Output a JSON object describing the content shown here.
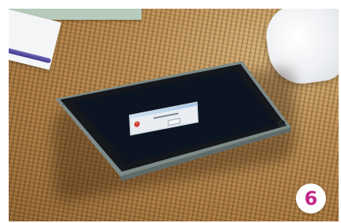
{
  "scene": {
    "description_items": [
      "book-icon",
      "paper-icon",
      "pen-icon",
      "tissue-icon",
      "tablet-icon",
      "error-dialog"
    ],
    "colors": {
      "badge_number": "#c2268a",
      "rug": "#b98a4f",
      "tablet_frame": "#6b7a78",
      "screen": "#0b1420"
    }
  },
  "badge": {
    "number": "6"
  }
}
